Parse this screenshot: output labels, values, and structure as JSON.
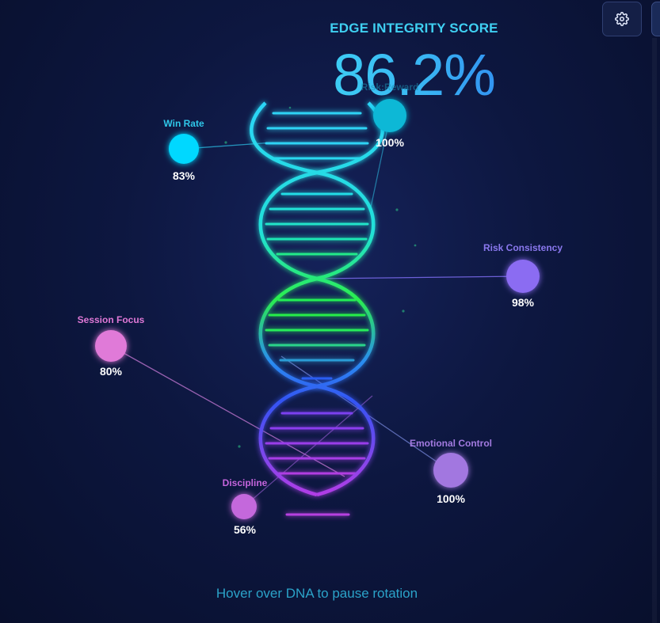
{
  "header": {
    "title": "EDGE INTEGRITY SCORE",
    "score": "86.2%"
  },
  "toolbar": {
    "settings_icon": "gear-icon"
  },
  "nodes": [
    {
      "id": "win-rate",
      "label": "Win Rate",
      "value": "83%",
      "color": "#00d8ff"
    },
    {
      "id": "risk-reward",
      "label": "Risk:Reward",
      "value": "100%",
      "color": "#11b8d6"
    },
    {
      "id": "risk-consistency",
      "label": "Risk Consistency",
      "value": "98%",
      "color": "#8b6cf2"
    },
    {
      "id": "session-focus",
      "label": "Session Focus",
      "value": "80%",
      "color": "#e07ad8"
    },
    {
      "id": "emotional-control",
      "label": "Emotional Control",
      "value": "100%",
      "color": "#a277e0"
    },
    {
      "id": "discipline",
      "label": "Discipline",
      "value": "56%",
      "color": "#c467dc"
    }
  ],
  "footer": {
    "hint": "Hover over DNA to pause rotation"
  },
  "colors": {
    "cyan": "#22d6f5",
    "teal": "#1ee8c8",
    "green": "#22ee55",
    "blue": "#2c5cf2",
    "purple": "#9a3cf0"
  }
}
